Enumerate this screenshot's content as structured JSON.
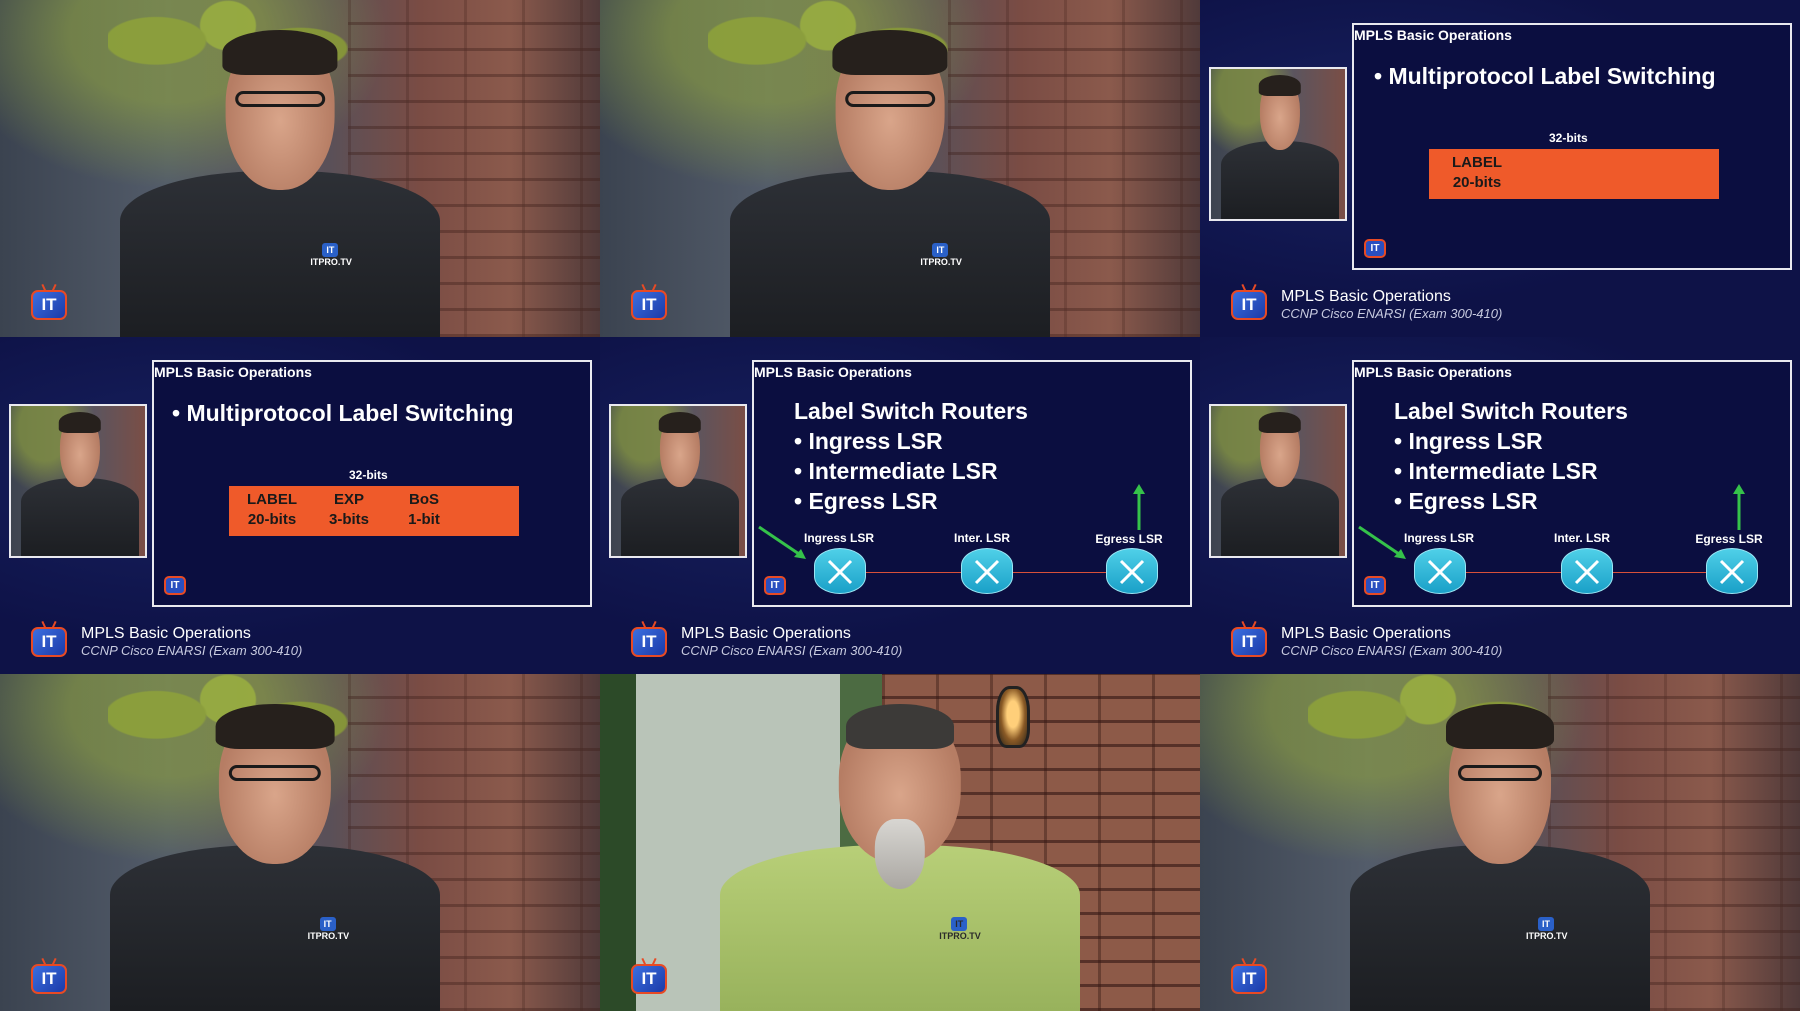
{
  "brand": {
    "logo_text": "IT",
    "shirt_logo": "ITPRO.TV"
  },
  "footer": {
    "title": "MPLS Basic Operations",
    "subtitle": "CCNP Cisco ENARSI (Exam 300-410)"
  },
  "slides": {
    "title": "MPLS Basic Operations",
    "mpls_bullet": "• Multiprotocol Label Switching",
    "bits_label": "32-bits",
    "fields": [
      {
        "name": "LABEL",
        "size": "20-bits"
      },
      {
        "name": "EXP",
        "size": "3-bits"
      },
      {
        "name": "BoS",
        "size": "1-bit"
      }
    ],
    "lsr_heading": "Label Switch Routers",
    "lsr_items": [
      "• Ingress LSR",
      "• Intermediate LSR",
      "• Egress LSR"
    ],
    "routers": [
      "Ingress LSR",
      "Inter. LSR",
      "Egress LSR"
    ]
  },
  "colors": {
    "accent": "#ef5a2a",
    "slide_bg": "#0b0e40",
    "router": "#2bb8dc"
  }
}
